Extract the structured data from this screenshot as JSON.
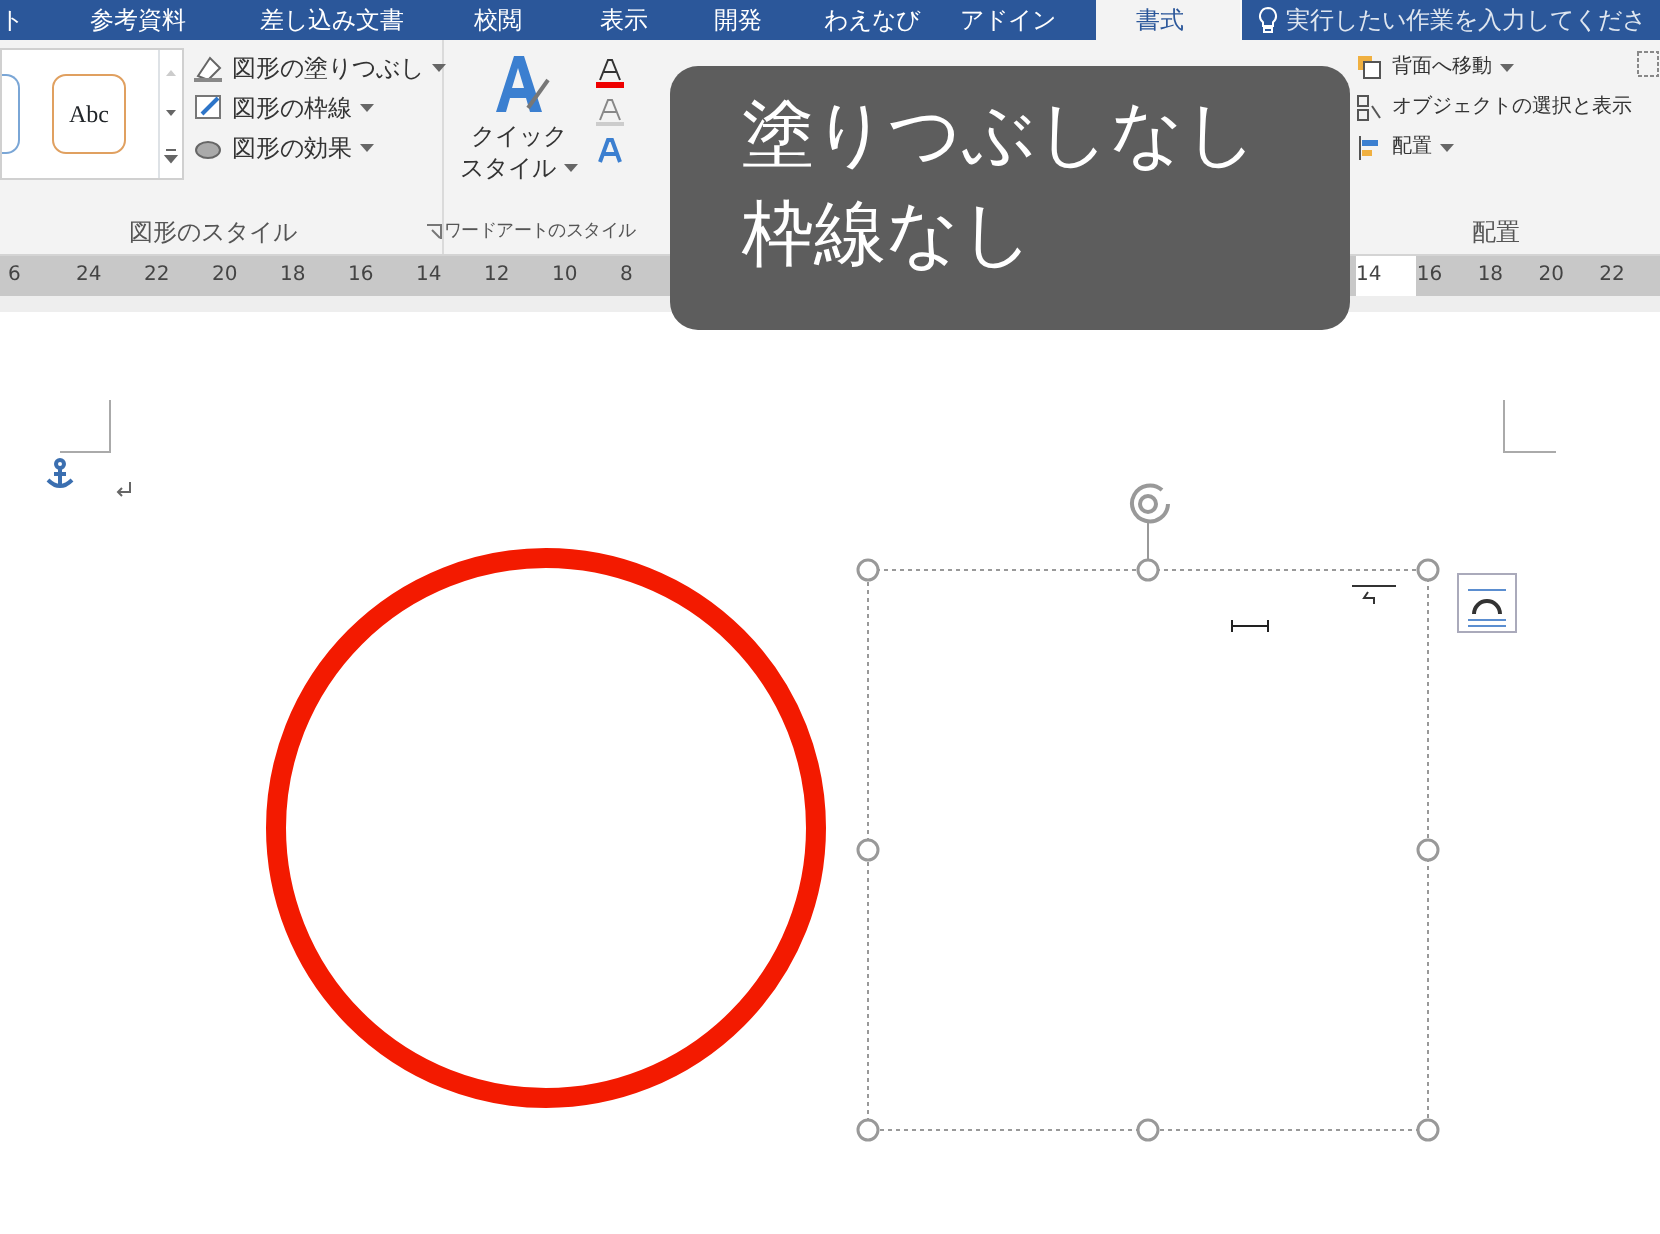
{
  "tabs": [
    {
      "label": "ト",
      "selected": false
    },
    {
      "label": "参考資料",
      "selected": false
    },
    {
      "label": "差し込み文書",
      "selected": false
    },
    {
      "label": "校閲",
      "selected": false
    },
    {
      "label": "表示",
      "selected": false
    },
    {
      "label": "開発",
      "selected": false
    },
    {
      "label": "わえなび",
      "selected": false
    },
    {
      "label": "アドイン",
      "selected": false
    },
    {
      "label": "書式",
      "selected": true
    }
  ],
  "tell_me": {
    "placeholder": "実行したい作業を入力してくださ"
  },
  "ribbon": {
    "shape_styles": {
      "label": "図形のスタイル",
      "gallery": [
        "Abc"
      ],
      "commands": [
        {
          "label": "図形の塗りつぶし",
          "dropdown": true
        },
        {
          "label": "図形の枠線",
          "dropdown": true
        },
        {
          "label": "図形の効果",
          "dropdown": true
        }
      ]
    },
    "wordart_styles": {
      "label": "ワードアートのスタイル",
      "quick_style": {
        "lines": [
          "クイック",
          "スタイル"
        ],
        "dropdown": true
      }
    },
    "arrange": {
      "label": "配置",
      "commands": [
        {
          "label": "背面へ移動",
          "dropdown": true
        },
        {
          "label": "オブジェクトの選択と表示",
          "dropdown": false
        },
        {
          "label": "配置",
          "dropdown": true
        }
      ]
    }
  },
  "ruler": {
    "left_numbers": [
      "6",
      "24",
      "22",
      "20",
      "18",
      "16",
      "14",
      "12",
      "10",
      "8"
    ],
    "right_numbers": [
      "14",
      "16",
      "18",
      "20",
      "22"
    ]
  },
  "caption": {
    "lines": [
      "塗りつぶしなし",
      "枠線なし"
    ]
  }
}
